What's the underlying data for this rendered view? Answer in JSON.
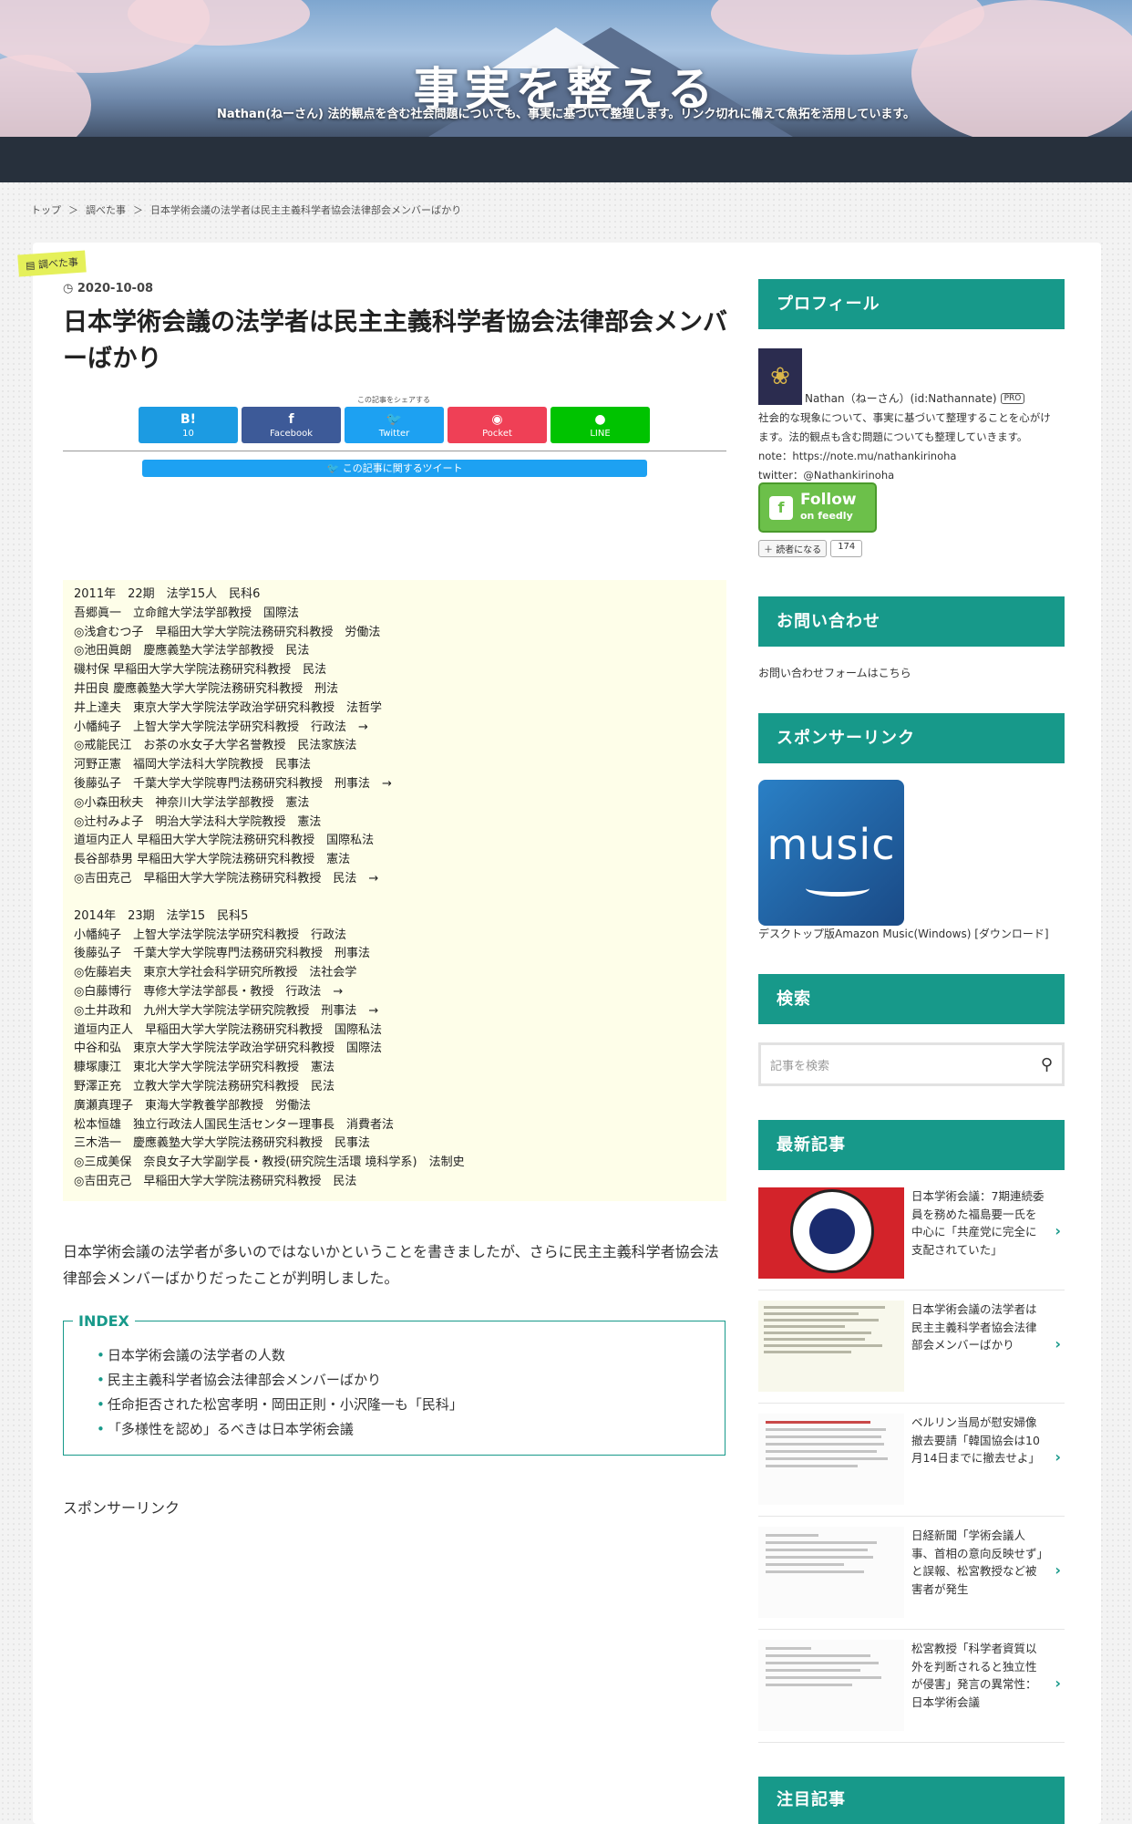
{
  "site": {
    "title": "事実を整える",
    "description": "Nathan(ねーさん) 法的観点を含む社会問題についても、事実に基づいて整理します。リンク切れに備えて魚拓を活用しています。"
  },
  "breadcrumb": {
    "home": "トップ",
    "sep": "＞",
    "category": "調べた事",
    "current": "日本学術会議の法学者は民主主義科学者協会法律部会メンバーばかり"
  },
  "post": {
    "category": "調べた事",
    "date": "2020-10-08",
    "title": "日本学術会議の法学者は民主主義科学者協会法律部会メンバーばかり",
    "share_caption": "この記事をシェアする",
    "share": [
      {
        "icon": "B!",
        "label": "10",
        "color": "#1c9be2"
      },
      {
        "icon": "f",
        "label": "Facebook",
        "color": "#3d5a98"
      },
      {
        "icon": "🐦",
        "label": "Twitter",
        "color": "#1da1f2"
      },
      {
        "icon": "◉",
        "label": "Pocket",
        "color": "#ef4056"
      },
      {
        "icon": "●",
        "label": "LINE",
        "color": "#00c300"
      }
    ],
    "tweet_bar": "この記事に関するツイート",
    "members_2011": [
      "2011年　22期　法学15人　民科6",
      "吾郷眞一　立命館大学法学部教授　国際法",
      "◎浅倉むつ子　早稲田大学大学院法務研究科教授　労働法",
      "◎池田眞朗　慶應義塾大学法学部教授　民法",
      "磯村保 早稲田大学大学院法務研究科教授　民法",
      "井田良 慶應義塾大学大学院法務研究科教授　刑法",
      "井上達夫　東京大学大学院法学政治学研究科教授　法哲学",
      "小幡純子　上智大学大学院法学研究科教授　行政法　→",
      "◎戒能民江　お茶の水女子大学名誉教授　民法家族法",
      "河野正憲　福岡大学法科大学院教授　民事法",
      "後藤弘子　千葉大学大学院専門法務研究科教授　刑事法　→",
      "◎小森田秋夫　神奈川大学法学部教授　憲法",
      "◎辻村みよ子　明治大学法科大学院教授　憲法",
      "道垣内正人 早稲田大学大学院法務研究科教授　国際私法",
      "長谷部恭男 早稲田大学大学院法務研究科教授　憲法",
      "◎吉田克己　早稲田大学大学院法務研究科教授　民法　→"
    ],
    "members_2014": [
      "2014年　23期　法学15　民科5",
      "小幡純子　上智大学法学院法学研究科教授　行政法",
      "後藤弘子　千葉大学大学院専門法務研究科教授　刑事法",
      "◎佐藤岩夫　東京大学社会科学研究所教授　法社会学",
      "◎白藤博行　専修大学法学部長・教授　行政法　→",
      "◎土井政和　九州大学大学院法学研究院教授　刑事法　→",
      "道垣内正人　早稲田大学大学院法務研究科教授　国際私法",
      "中谷和弘　東京大学大学院法学政治学研究科教授　国際法",
      "糠塚康江　東北大学大学院法学研究科教授　憲法",
      "野澤正充　立教大学大学院法務研究科教授　民法",
      "廣瀬真理子　東海大学教養学部教授　労働法",
      "松本恒雄　独立行政法人国民生活センター理事長　消費者法",
      "三木浩一　慶應義塾大学大学院法務研究科教授　民事法",
      "◎三成美保　奈良女子大学副学長・教授(研究院生活環 境科学系)　法制史",
      "◎吉田克己　早稲田大学大学院法務研究科教授　民法"
    ],
    "intro": "日本学術会議の法学者が多いのではないかということを書きましたが、さらに民主主義科学者協会法律部会メンバーばかりだったことが判明しました。",
    "index_title": "INDEX",
    "index": [
      "日本学術会議の法学者の人数",
      "民主主義科学者協会法律部会メンバーばかり",
      "任命拒否された松宮孝明・岡田正則・小沢隆一も「民科」",
      "「多様性を認め」るべきは日本学術会議"
    ],
    "sponsor": "スポンサーリンク"
  },
  "sidebar": {
    "profile_title": "プロフィール",
    "profile_name": "Nathan（ねーさん）(id:Nathannate)",
    "profile_badge": "PRO",
    "profile_lines": [
      "社会的な現象について、事実に基づいて整理することを心がけ",
      "ます。法的観点も含む問題についても整理していきます。",
      "note：https://note.mu/nathankirinoha",
      "twitter：@Nathankirinoha"
    ],
    "feedly_follow": "Follow",
    "feedly_on": "on feedly",
    "reader_label": "読者になる",
    "reader_count": "174",
    "contact_title": "お問い合わせ",
    "contact_link": "お問い合わせフォームはこちら",
    "sponsor_title": "スポンサーリンク",
    "music_logo": "music",
    "music_caption": "デスクトップ版Amazon Music(Windows) [ダウンロード]",
    "search_title": "検索",
    "search_placeholder": "記事を検索",
    "recent_title": "最新記事",
    "recent": [
      "日本学術会議：7期連続委員を務めた福島要一氏を中心に「共産党に完全に支配されていた」",
      "日本学術会議の法学者は民主主義科学者協会法律部会メンバーばかり",
      "ベルリン当局が慰安婦像撤去要請「韓国協会は10月14日までに撤去せよ」",
      "日経新聞「学術会議人事、首相の意向反映せず」と誤報、松宮教授など被害者が発生",
      "松宮教授「科学者資質以外を判断されると独立性が侵害」発言の異常性：日本学術会議"
    ],
    "featured_title": "注目記事"
  }
}
